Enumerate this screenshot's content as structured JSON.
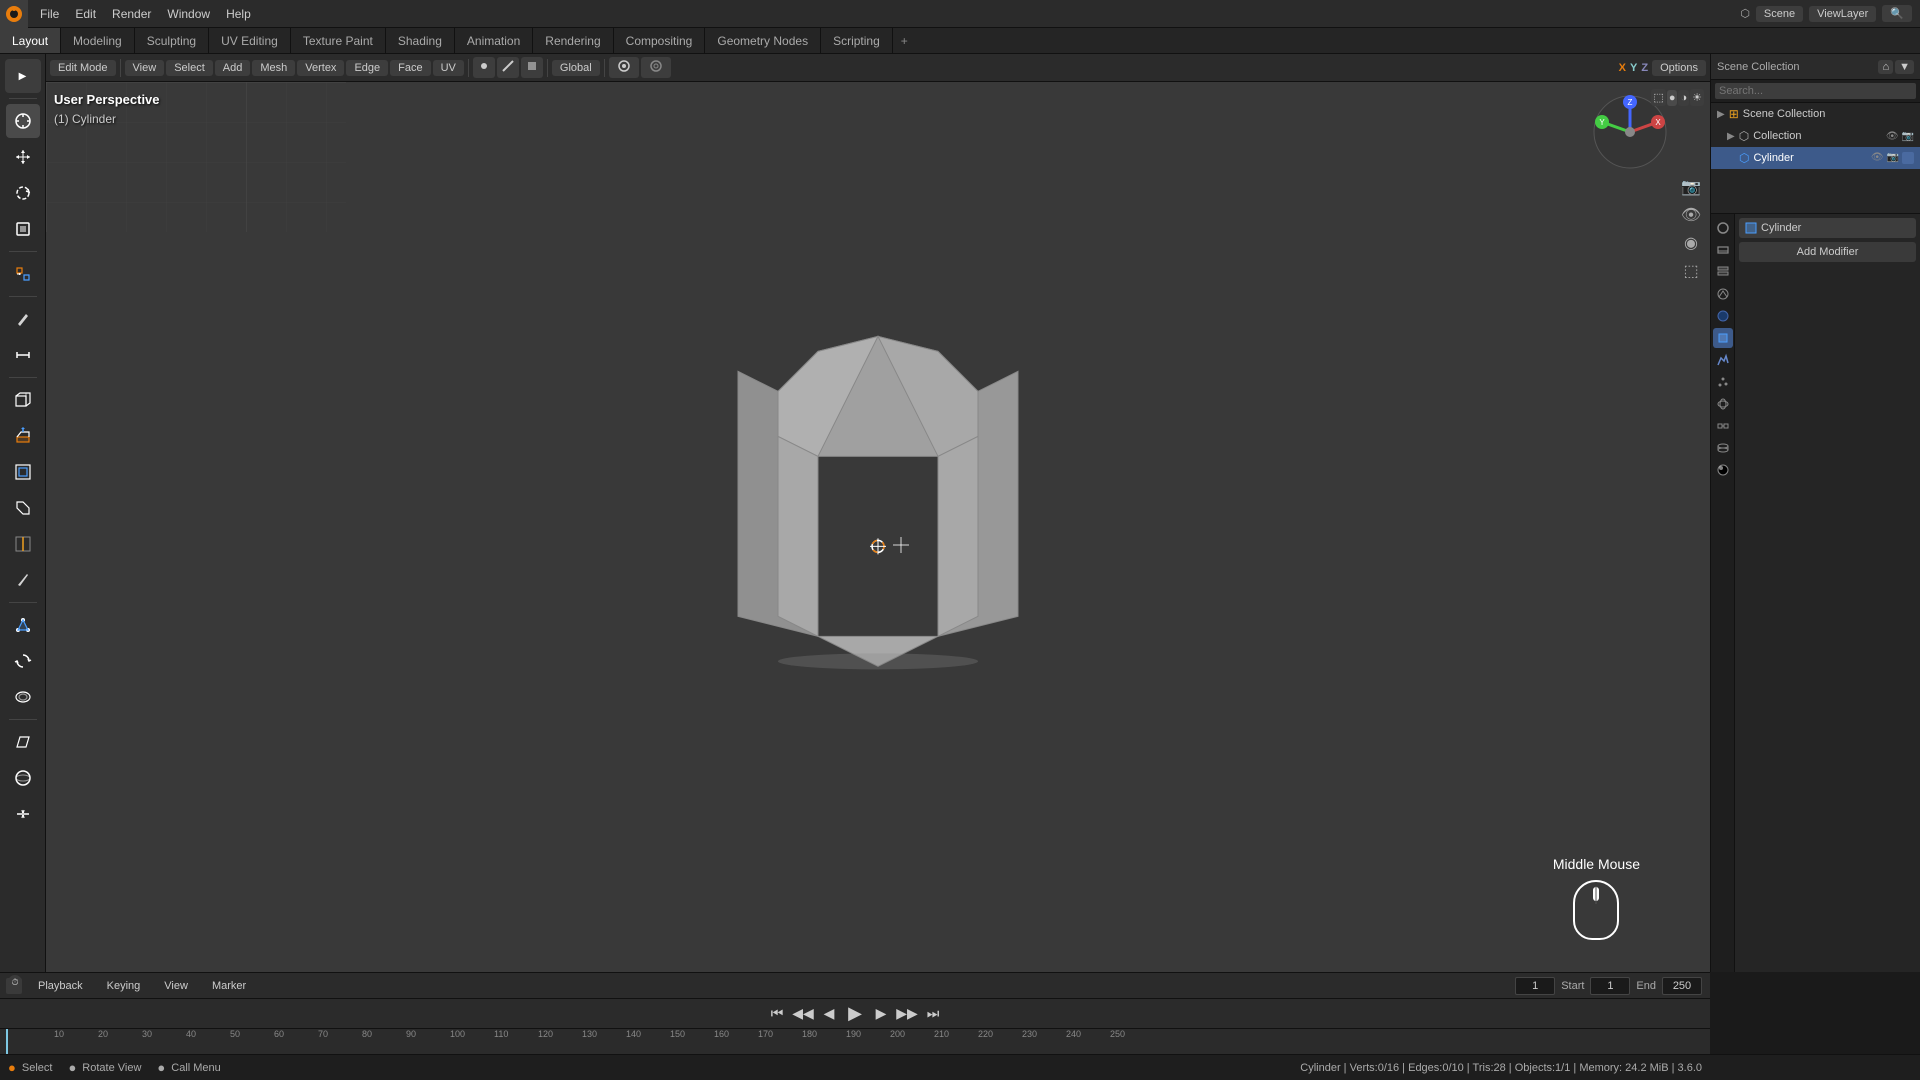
{
  "app": {
    "title": "Blender",
    "version": "3.x"
  },
  "top_menu": {
    "items": [
      "File",
      "Edit",
      "Render",
      "Window",
      "Help"
    ]
  },
  "workspace_tabs": {
    "tabs": [
      "Layout",
      "Modeling",
      "Sculpting",
      "UV Editing",
      "Texture Paint",
      "Shading",
      "Animation",
      "Rendering",
      "Compositing",
      "Geometry Nodes",
      "Scripting"
    ],
    "active": "Layout"
  },
  "viewport_header": {
    "mode": "Edit Mode",
    "view_menu": "View",
    "select_menu": "Select",
    "add_menu": "Add",
    "mesh_menu": "Mesh",
    "vertex_menu": "Vertex",
    "edge_menu": "Edge",
    "face_menu": "Face",
    "uv_menu": "UV",
    "transform": "Global",
    "proportional": "Proportional Editing",
    "snapping": "Snapping",
    "options_menu": "Options",
    "x_label": "X",
    "y_label": "Y",
    "z_label": "Z"
  },
  "viewport_info": {
    "perspective": "User Perspective",
    "object": "(1) Cylinder"
  },
  "scene": {
    "name": "Scene",
    "view_layer": "ViewLayer"
  },
  "outliner": {
    "title": "Scene Collection",
    "items": [
      {
        "name": "Scene Collection",
        "icon": "scene",
        "level": 0
      },
      {
        "name": "Collection",
        "icon": "collection",
        "level": 1
      },
      {
        "name": "Cylinder",
        "icon": "cylinder",
        "level": 2,
        "active": true
      }
    ]
  },
  "properties": {
    "object_name": "Cylinder",
    "add_modifier_label": "Add Modifier",
    "tabs": [
      "scene",
      "render",
      "output",
      "view_layer",
      "scene2",
      "world",
      "object",
      "modifiers",
      "particles",
      "physics",
      "constraints",
      "data",
      "material"
    ]
  },
  "timeline": {
    "header_items": [
      "Playback",
      "Keying",
      "View",
      "Marker"
    ],
    "current_frame": "1",
    "start_label": "Start",
    "start_value": "1",
    "end_label": "End",
    "end_value": "250",
    "ruler_marks": [
      "10",
      "20",
      "30",
      "40",
      "50",
      "60",
      "70",
      "80",
      "90",
      "100",
      "110",
      "120",
      "130",
      "140",
      "150",
      "160",
      "170",
      "180",
      "190",
      "200",
      "210",
      "220",
      "230",
      "240",
      "250"
    ]
  },
  "playback_controls": {
    "jump_start": "⏮",
    "prev_frame": "⏪",
    "prev_keyframe": "◀",
    "play": "▶",
    "next_keyframe": "▶",
    "next_frame": "⏩",
    "jump_end": "⏭"
  },
  "mouse_hint": {
    "label": "Middle Mouse"
  },
  "status_bar": {
    "select": "Select",
    "rotate": "Rotate View",
    "call_menu": "Call Menu",
    "info": "Cylinder | Verts:0/16 | Edges:0/10 | Tris:28 | Objects:1/1 | Memory: 24.2 MiB | 3.6.0"
  }
}
